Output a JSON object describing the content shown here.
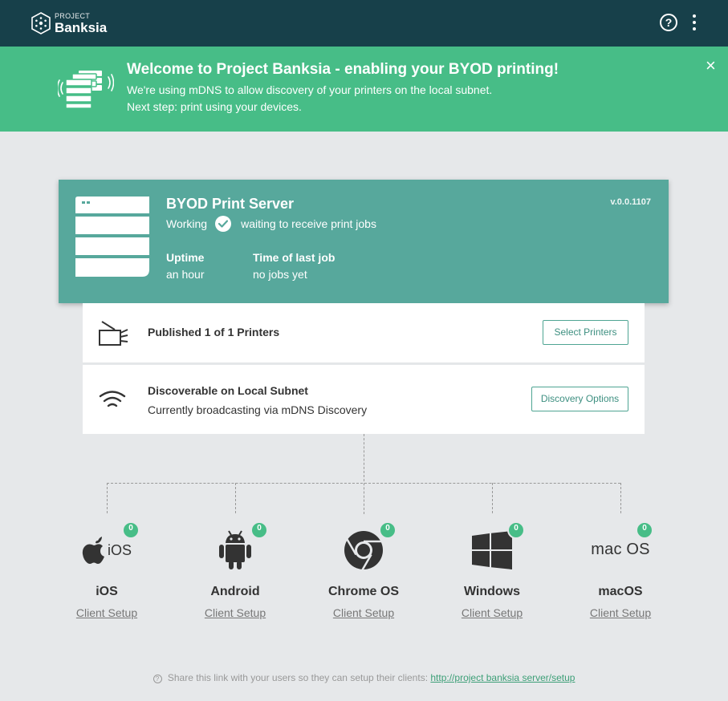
{
  "app": {
    "logo_small": "PROJECT",
    "logo_big": "Banksia",
    "help_label": "?"
  },
  "banner": {
    "title": "Welcome to Project Banksia - enabling your BYOD printing!",
    "line1": "We're using mDNS to allow discovery of your printers on the local subnet.",
    "line2": "Next step: print using your devices.",
    "close_label": "×"
  },
  "server": {
    "title": "BYOD Print Server",
    "state": "Working",
    "status_text": "waiting to receive print jobs",
    "version": "v.0.0.1107",
    "uptime_label": "Uptime",
    "uptime_value": "an hour",
    "last_job_label": "Time of last job",
    "last_job_value": "no jobs yet"
  },
  "printers": {
    "title": "Published 1 of 1 Printers",
    "button_label": "Select Printers"
  },
  "discovery": {
    "title": "Discoverable on Local Subnet",
    "subtitle": "Currently broadcasting via mDNS Discovery",
    "button_label": "Discovery Options"
  },
  "platforms": [
    {
      "name": "iOS",
      "logo_text": "iOS",
      "count": "0",
      "link": "Client Setup",
      "icon": "apple-icon"
    },
    {
      "name": "Android",
      "count": "0",
      "link": "Client Setup",
      "icon": "android-icon"
    },
    {
      "name": "Chrome OS",
      "count": "0",
      "link": "Client Setup",
      "icon": "chrome-icon"
    },
    {
      "name": "Windows",
      "count": "0",
      "link": "Client Setup",
      "icon": "windows-icon"
    },
    {
      "name": "macOS",
      "logo_text": "mac OS",
      "count": "0",
      "link": "Client Setup",
      "icon": "macos-icon"
    }
  ],
  "footer": {
    "info_icon": "?",
    "text": "Share this link with your users so they can setup their clients:",
    "link": "http://project banksia server/setup"
  },
  "colors": {
    "topbar": "#17404a",
    "banner": "#47bd87",
    "server_card": "#57a89c",
    "background": "#e6e8ea",
    "button_border": "#4fa593"
  }
}
